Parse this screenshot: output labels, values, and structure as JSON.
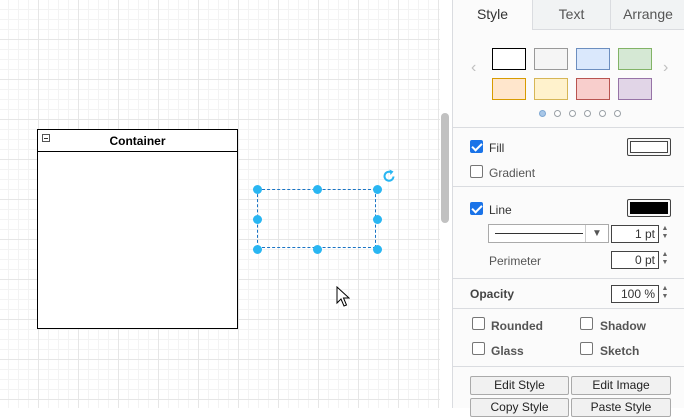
{
  "canvas": {
    "container_title": "Container"
  },
  "panel": {
    "tabs": [
      {
        "label": "Style",
        "active": true
      },
      {
        "label": "Text",
        "active": false
      },
      {
        "label": "Arrange",
        "active": false
      }
    ],
    "swatches": [
      "#ffffff",
      "#f5f5f5",
      "#dae8fc",
      "#d5e8d4",
      "#ffe6cc",
      "#fff2cc",
      "#f8cecc",
      "#e1d5e7"
    ],
    "fill": {
      "label": "Fill",
      "checked": true,
      "color": "#ffffff"
    },
    "gradient": {
      "label": "Gradient",
      "checked": false
    },
    "line": {
      "label": "Line",
      "checked": true,
      "color": "#000000",
      "width_value": "1 pt"
    },
    "perimeter": {
      "label": "Perimeter",
      "value": "0 pt"
    },
    "opacity": {
      "label": "Opacity",
      "value": "100 %"
    },
    "options": {
      "rounded": "Rounded",
      "shadow": "Shadow",
      "glass": "Glass",
      "sketch": "Sketch"
    },
    "buttons": {
      "edit_style": "Edit Style",
      "edit_image": "Edit Image",
      "copy_style": "Copy Style",
      "paste_style": "Paste Style"
    }
  },
  "colors": {
    "selection": "#29b6f2",
    "accent": "#1a73e8"
  },
  "icons": [
    "collapse-icon",
    "rotate-icon",
    "chevron-left-icon",
    "chevron-right-icon",
    "dropdown-arrow-icon",
    "mouse-cursor-icon"
  ]
}
